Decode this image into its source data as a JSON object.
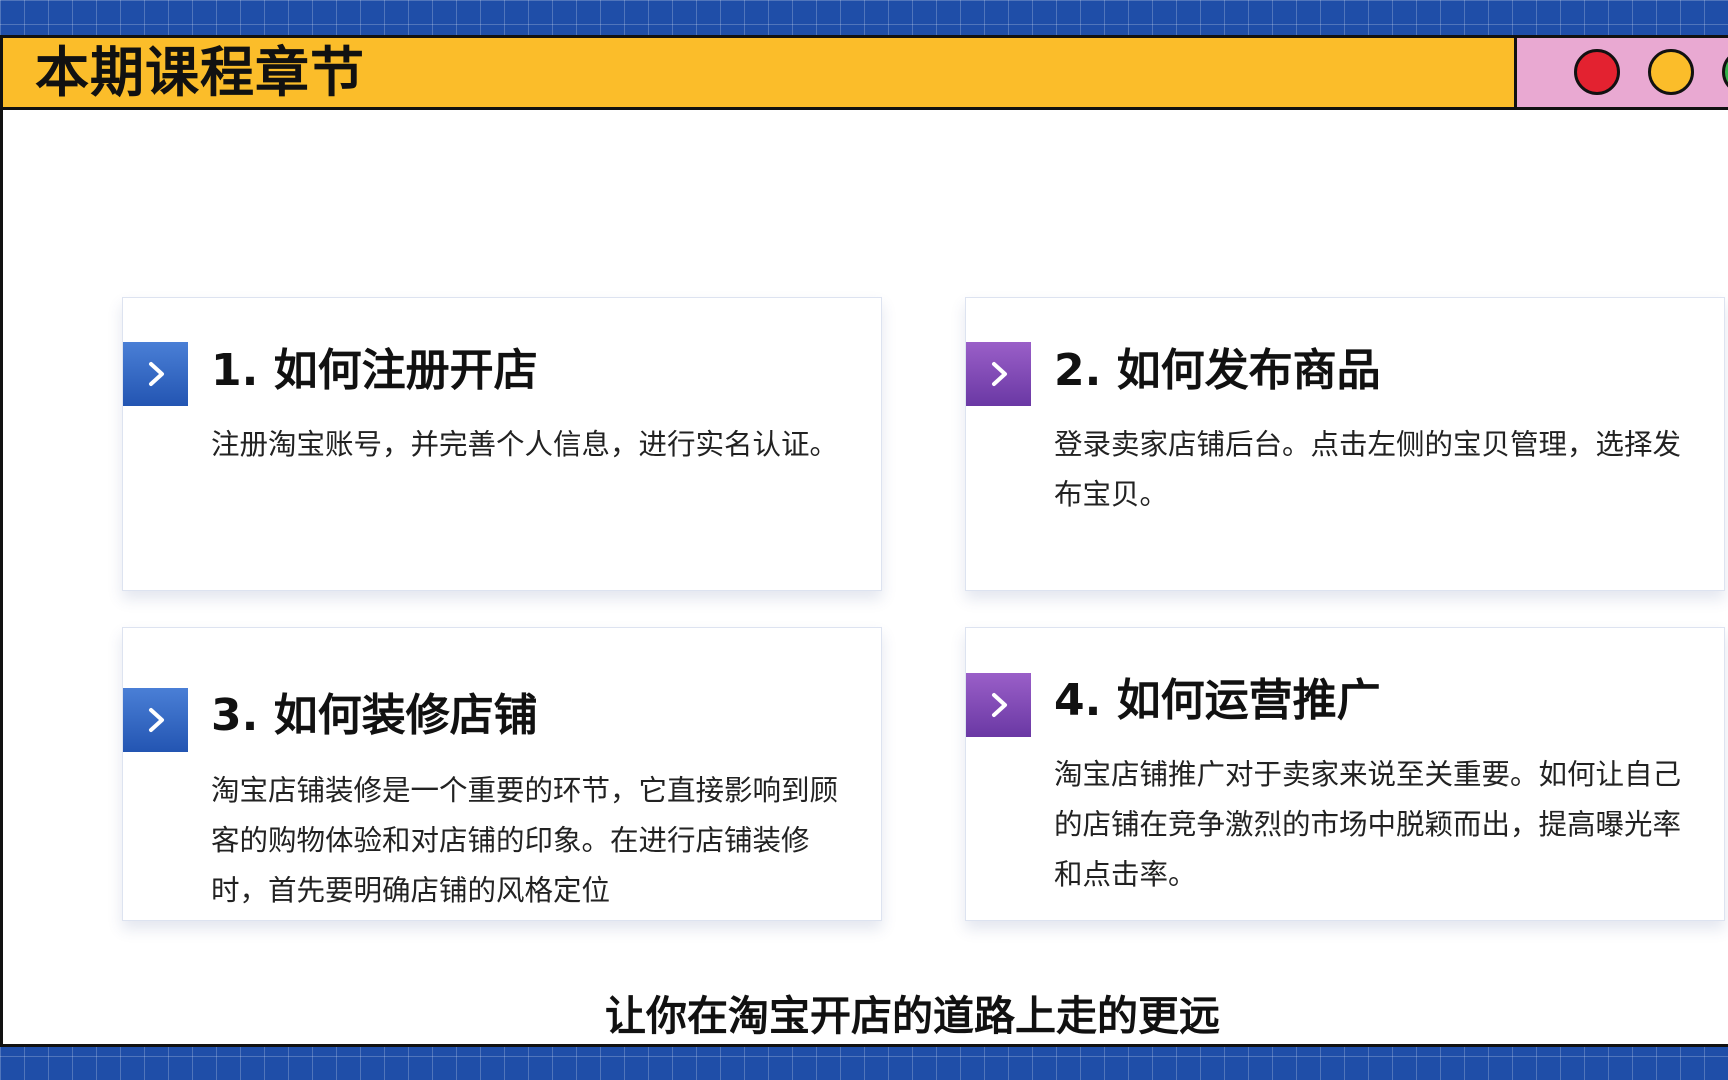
{
  "window": {
    "title": "本期课程章节"
  },
  "controls": {
    "icons": [
      "close-dot",
      "minimize-dot",
      "maximize-dot"
    ],
    "colors": [
      "#e32230",
      "#fbbd2a",
      "#35b24a"
    ]
  },
  "cards": [
    {
      "title": "1. 如何注册开店",
      "description": "注册淘宝账号，并完善个人信息，进行实名认证。",
      "icon": "chevron-right-icon",
      "accent": "#2f65c2"
    },
    {
      "title": "2. 如何发布商品",
      "description": "登录卖家店铺后台。点击左侧的宝贝管理，选择发布宝贝。",
      "icon": "chevron-right-icon",
      "accent": "#7e48b6"
    },
    {
      "title": "3. 如何装修店铺",
      "description": "淘宝店铺装修是一个重要的环节，它直接影响到顾客的购物体验和对店铺的印象。在进行店铺装修时，首先要明确店铺的风格定位",
      "icon": "chevron-right-icon",
      "accent": "#2f65c2"
    },
    {
      "title": "4. 如何运营推广",
      "description": "淘宝店铺推广对于卖家来说至关重要。如何让自己的店铺在竞争激烈的市场中脱颖而出，提高曝光率和点击率。",
      "icon": "chevron-right-icon",
      "accent": "#7e48b6"
    }
  ],
  "subtitle": "让你在淘宝开店的道路上走的更远"
}
